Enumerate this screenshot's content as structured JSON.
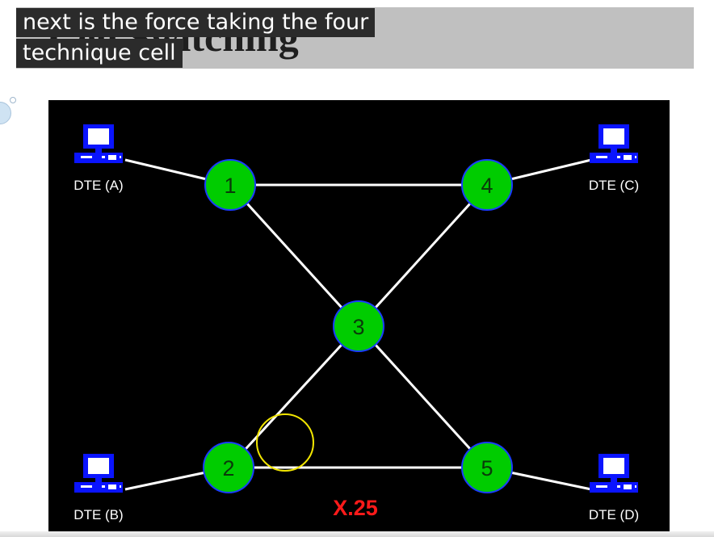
{
  "slide": {
    "title": "Cell Switching"
  },
  "captions": [
    "next is the force taking the four",
    "technique cell"
  ],
  "diagram": {
    "protocol_label": "X.25",
    "nodes": [
      "1",
      "2",
      "3",
      "4",
      "5"
    ],
    "terminals": [
      "DTE (A)",
      "DTE (B)",
      "DTE (C)",
      "DTE (D)"
    ],
    "colors": {
      "background": "#000000",
      "node_fill": "#00cc00",
      "node_outline": "#1a3cff",
      "link": "#ffffff",
      "terminal": "#0a14ff",
      "protocol_label": "#ff1a1a",
      "cursor_ring": "#f2e600"
    }
  }
}
